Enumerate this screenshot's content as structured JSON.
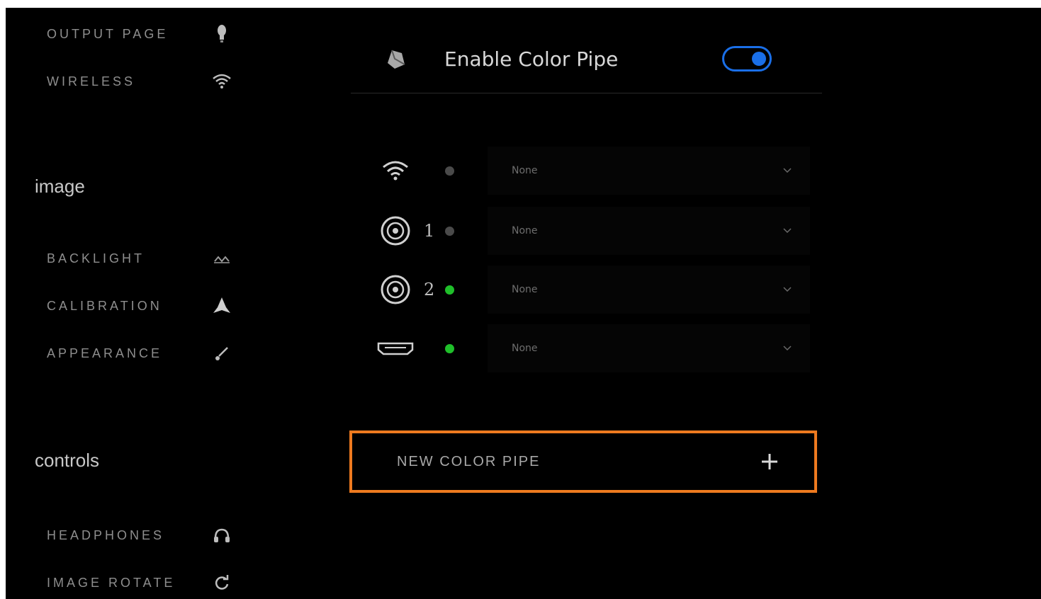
{
  "sidebar": {
    "top_items": [
      {
        "label": "OUTPUT PAGE",
        "icon": "lightbulb-icon"
      },
      {
        "label": "WIRELESS",
        "icon": "wifi-icon"
      }
    ],
    "sections": [
      {
        "title": "image",
        "items": [
          {
            "label": "BACKLIGHT",
            "icon": "backlight-icon"
          },
          {
            "label": "CALIBRATION",
            "icon": "calibration-icon"
          },
          {
            "label": "APPEARANCE",
            "icon": "brush-icon"
          }
        ]
      },
      {
        "title": "controls",
        "items": [
          {
            "label": "HEADPHONES",
            "icon": "headphones-icon"
          },
          {
            "label": "IMAGE ROTATE",
            "icon": "rotate-icon"
          }
        ]
      }
    ]
  },
  "main": {
    "header": {
      "title": "Enable Color Pipe",
      "icon": "color-pipe-icon",
      "toggle_on": true,
      "accent_color": "#1a6fe8"
    },
    "inputs": [
      {
        "icon": "wifi-icon",
        "number": "",
        "status_color": "#4a4a4a",
        "selection": "None"
      },
      {
        "icon": "sdi-connector-icon",
        "number": "1",
        "status_color": "#4a4a4a",
        "selection": "None"
      },
      {
        "icon": "sdi-connector-icon",
        "number": "2",
        "status_color": "#1fbf2a",
        "selection": "None"
      },
      {
        "icon": "hdmi-icon",
        "number": "",
        "status_color": "#1fbf2a",
        "selection": "None"
      }
    ],
    "new_pipe": {
      "label": "NEW COLOR PIPE",
      "icon": "plus-icon",
      "highlight_color": "#ee7a1f"
    }
  }
}
